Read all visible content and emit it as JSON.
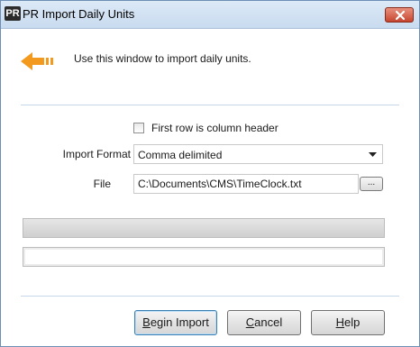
{
  "window": {
    "app_icon_text": "PR",
    "title": "PR Import Daily Units"
  },
  "header": {
    "instruction": "Use this window to import daily units."
  },
  "options": {
    "first_row_header_label": "First row is column header",
    "first_row_header_checked": false
  },
  "import_format": {
    "label": "Import Format",
    "value": "Comma delimited"
  },
  "file": {
    "label": "File",
    "value": "C:\\Documents\\CMS\\TimeClock.txt",
    "browse_label": "..."
  },
  "progress": {
    "value": 0
  },
  "buttons": {
    "begin_import": {
      "accel": "B",
      "rest": "egin Import"
    },
    "cancel": {
      "accel": "C",
      "rest": "ancel"
    },
    "help": {
      "accel": "H",
      "rest": "elp"
    }
  },
  "colors": {
    "accent_arrow": "#f39a1e",
    "close_button": "#c7452f",
    "titlebar": "#c9dbef"
  }
}
